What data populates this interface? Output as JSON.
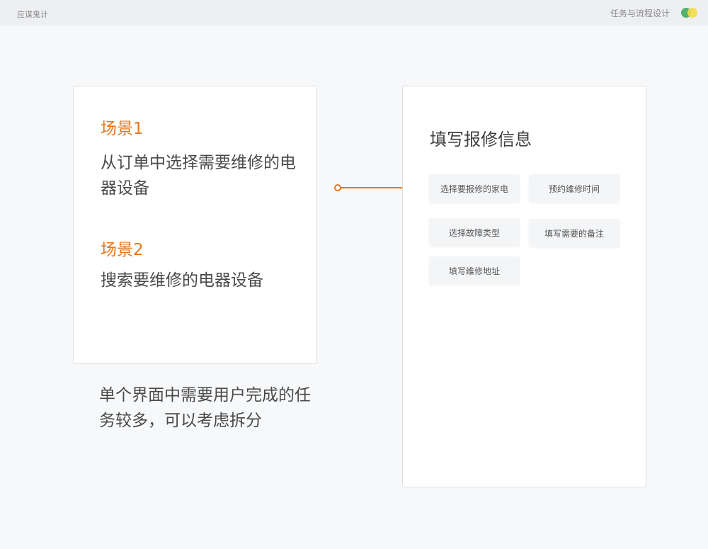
{
  "header": {
    "brand": "应谋鬼计",
    "section_title": "任务与流程设计"
  },
  "scenarios": [
    {
      "label": "场景1",
      "text": "从订单中选择需要维修的电器设备"
    },
    {
      "label": "场景2",
      "text": "搜索要维修的电器设备"
    }
  ],
  "note": "单个界面中需要用户完成的任务较多，可以考虑拆分",
  "form": {
    "title": "填写报修信息",
    "tasks": [
      "选择要报修的家电",
      "预约维修时间",
      "选择故障类型",
      "填写需要的备注",
      "填写维修地址"
    ]
  },
  "colors": {
    "accent": "#e8771c",
    "background": "#f7f8fa",
    "text": "#4a4a4a"
  }
}
